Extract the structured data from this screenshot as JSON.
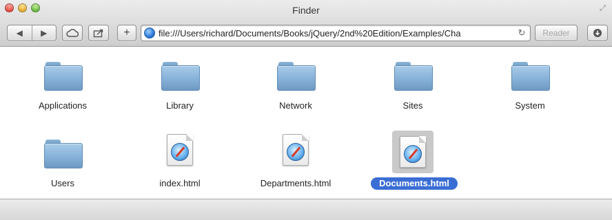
{
  "window": {
    "title": "Finder"
  },
  "toolbar": {
    "back_icon": "back-arrow-icon",
    "forward_icon": "forward-arrow-icon",
    "cloud_icon": "icloud-icon",
    "share_icon": "share-icon",
    "add_icon": "plus-icon",
    "address": "file:///Users/richard/Documents/Books/jQuery/2nd%20Edition/Examples/Cha",
    "reload_icon": "reload-icon",
    "reader_label": "Reader",
    "downloads_icon": "downloads-icon"
  },
  "items": [
    {
      "label": "Applications",
      "type": "folder"
    },
    {
      "label": "Library",
      "type": "folder"
    },
    {
      "label": "Network",
      "type": "folder"
    },
    {
      "label": "Sites",
      "type": "folder"
    },
    {
      "label": "System",
      "type": "folder"
    },
    {
      "label": "Users",
      "type": "folder"
    },
    {
      "label": "index.html",
      "type": "html-document"
    },
    {
      "label": "Departments.html",
      "type": "html-document"
    },
    {
      "label": "Documents.html",
      "type": "html-document",
      "selected": true
    }
  ],
  "colors": {
    "selection": "#3b6ed5",
    "folder": "#86b1d8"
  }
}
